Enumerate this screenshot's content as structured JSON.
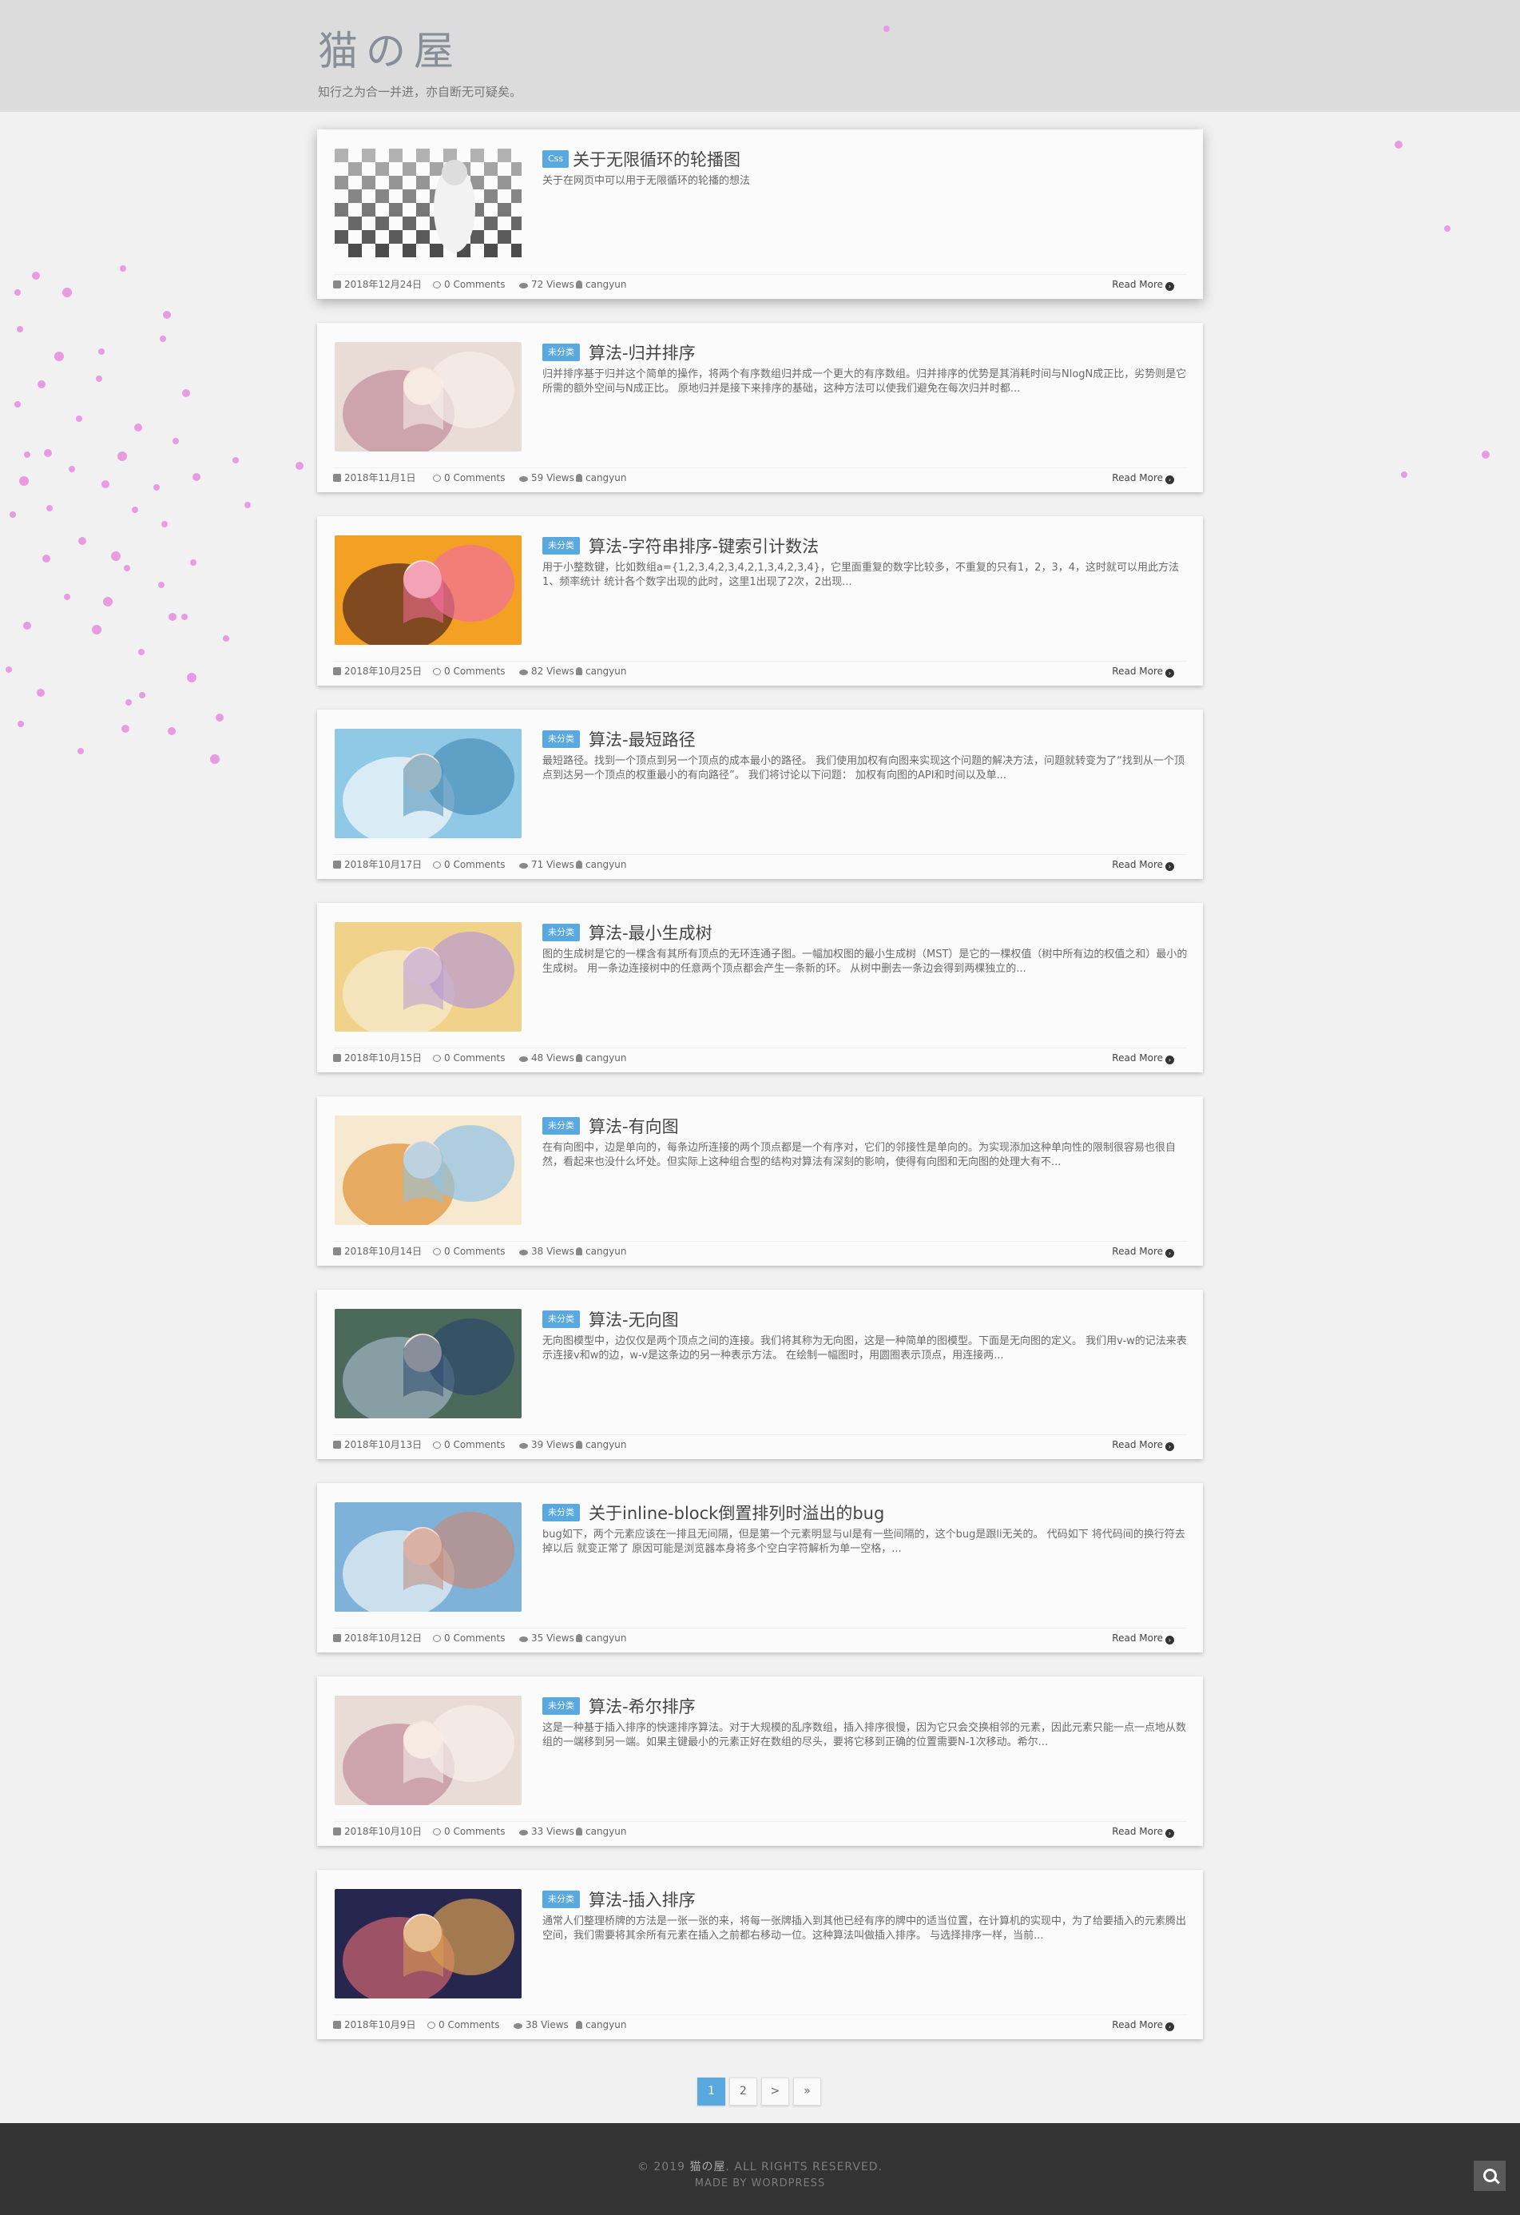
{
  "site": {
    "title": "猫の屋",
    "description": "知行之为合一并进，亦自断无可疑矣。"
  },
  "posts": [
    {
      "category": "Css",
      "title": "关于无限循环的轮播图",
      "excerpt": "关于在网页中可以用于无限循环的轮播的想法",
      "date": "2018年12月24日",
      "comments": "0 Comments",
      "views": "72 Views",
      "author": "cangyun",
      "read_more": "Read More"
    },
    {
      "category": "未分类",
      "title": "算法-归并排序",
      "excerpt": "归并排序基于归并这个简单的操作，将两个有序数组归并成一个更大的有序数组。归并排序的优势是其消耗时间与NlogN成正比，劣势则是它所需的额外空间与N成正比。 原地归并是接下来排序的基础，这种方法可以使我们避免在每次归并时都...",
      "date": "2018年11月1日",
      "comments": "0 Comments",
      "views": "59 Views",
      "author": "cangyun",
      "read_more": "Read More"
    },
    {
      "category": "未分类",
      "title": "算法-字符串排序-键索引计数法",
      "excerpt": "用于小整数键，比如数组a={1,2,3,4,2,3,4,2,1,3,4,2,3,4}，它里面重复的数字比较多，不重复的只有1，2，3，4，这时就可以用此方法 1、频率统计 统计各个数字出现的此时，这里1出现了2次，2出现...",
      "date": "2018年10月25日",
      "comments": "0 Comments",
      "views": "82 Views",
      "author": "cangyun",
      "read_more": "Read More"
    },
    {
      "category": "未分类",
      "title": "算法-最短路径",
      "excerpt": "最短路径。找到一个顶点到另一个顶点的成本最小的路径。 我们使用加权有向图来实现这个问题的解决方法，问题就转变为了“找到从一个顶点到达另一个顶点的权重最小的有向路径”。 我们将讨论以下问题： 加权有向图的API和时间以及单...",
      "date": "2018年10月17日",
      "comments": "0 Comments",
      "views": "71 Views",
      "author": "cangyun",
      "read_more": "Read More"
    },
    {
      "category": "未分类",
      "title": "算法-最小生成树",
      "excerpt": "图的生成树是它的一棵含有其所有顶点的无环连通子图。一幅加权图的最小生成树（MST）是它的一棵权值（树中所有边的权值之和）最小的生成树。 用一条边连接树中的任意两个顶点都会产生一条新的环。 从树中删去一条边会得到两棵独立的...",
      "date": "2018年10月15日",
      "comments": "0 Comments",
      "views": "48 Views",
      "author": "cangyun",
      "read_more": "Read More"
    },
    {
      "category": "未分类",
      "title": "算法-有向图",
      "excerpt": "在有向图中，边是单向的，每条边所连接的两个顶点都是一个有序对，它们的邻接性是单向的。为实现添加这种单向性的限制很容易也很自然，看起来也没什么坏处。但实际上这种组合型的结构对算法有深刻的影响，使得有向图和无向图的处理大有不...",
      "date": "2018年10月14日",
      "comments": "0 Comments",
      "views": "38 Views",
      "author": "cangyun",
      "read_more": "Read More"
    },
    {
      "category": "未分类",
      "title": "算法-无向图",
      "excerpt": "无向图模型中，边仅仅是两个顶点之间的连接。我们将其称为无向图，这是一种简单的图模型。下面是无向图的定义。 我们用v-w的记法来表示连接v和w的边，w-v是这条边的另一种表示方法。 在绘制一幅图时，用圆圈表示顶点，用连接两...",
      "date": "2018年10月13日",
      "comments": "0 Comments",
      "views": "39 Views",
      "author": "cangyun",
      "read_more": "Read More"
    },
    {
      "category": "未分类",
      "title": "关于inline-block倒置排列时溢出的bug",
      "excerpt": "bug如下，两个元素应该在一排且无间隔，但是第一个元素明显与ul是有一些间隔的，这个bug是跟li无关的。 代码如下 将代码间的换行符去掉以后 就变正常了   原因可能是浏览器本身将多个空白字符解析为单一空格，...",
      "date": "2018年10月12日",
      "comments": "0 Comments",
      "views": "35 Views",
      "author": "cangyun",
      "read_more": "Read More"
    },
    {
      "category": "未分类",
      "title": "算法-希尔排序",
      "excerpt": "这是一种基于插入排序的快速排序算法。对于大规模的乱序数组，插入排序很慢，因为它只会交换相邻的元素，因此元素只能一点一点地从数组的一端移到另一端。如果主键最小的元素正好在数组的尽头，要将它移到正确的位置需要N-1次移动。希尔...",
      "date": "2018年10月10日",
      "comments": "0 Comments",
      "views": "33 Views",
      "author": "cangyun",
      "read_more": "Read More"
    },
    {
      "category": "未分类",
      "title": "算法-插入排序",
      "excerpt": "通常人们整理桥牌的方法是一张一张的来，将每一张牌插入到其他已经有序的牌中的适当位置，在计算机的实现中，为了给要插入的元素腾出空间，我们需要将其余所有元素在插入之前都右移动一位。这种算法叫做插入排序。 与选择排序一样，当前...",
      "date": "2018年10月9日",
      "comments": "0 Comments",
      "views": "38 Views",
      "author": "cangyun",
      "read_more": "Read More"
    }
  ],
  "pagination": {
    "pages": [
      "1",
      "2",
      ">",
      "»"
    ],
    "current": "1"
  },
  "footer": {
    "copyright_prefix": "© 2019 ",
    "copyright_site": "猫の屋",
    "copyright_suffix": ". ALL RIGHTS RESERVED.",
    "made_by": "MADE BY WORDPRESS"
  },
  "icons": {
    "calendar": "calendar-icon",
    "comments": "comment-icon",
    "views": "eye-icon",
    "author": "user-icon",
    "read_more": "chevron-circle-right-icon",
    "search": "search-icon"
  },
  "colors": {
    "header_bg": "#dcdcdc",
    "accent": "#59a8e0",
    "footer_bg": "#333333",
    "particles": "#e79ce2"
  }
}
